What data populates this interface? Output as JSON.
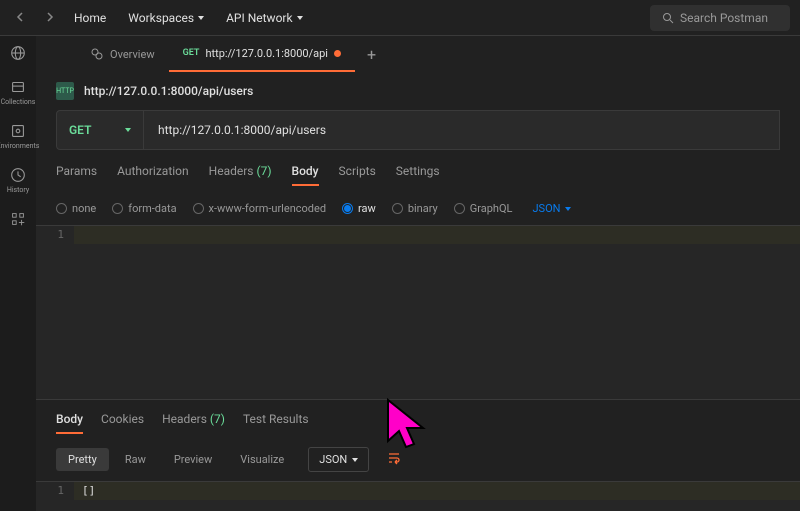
{
  "top": {
    "home": "Home",
    "workspaces": "Workspaces",
    "api_network": "API Network",
    "search_placeholder": "Search Postman"
  },
  "sidebar": {
    "collections": "Collections",
    "environments": "Environments",
    "history": "History"
  },
  "tabs": {
    "overview": "Overview",
    "active_method": "GET",
    "active_label": "http://127.0.0.1:8000/api"
  },
  "breadcrumb": {
    "url": "http://127.0.0.1:8000/api/users"
  },
  "request": {
    "method": "GET",
    "url": "http://127.0.0.1:8000/api/users"
  },
  "req_tabs": {
    "params": "Params",
    "authorization": "Authorization",
    "headers": "Headers",
    "headers_count": "(7)",
    "body": "Body",
    "scripts": "Scripts",
    "settings": "Settings"
  },
  "body_types": {
    "none": "none",
    "form_data": "form-data",
    "urlencoded": "x-www-form-urlencoded",
    "raw": "raw",
    "binary": "binary",
    "graphql": "GraphQL",
    "content_type": "JSON"
  },
  "editor": {
    "line1": "1",
    "line1_content": ""
  },
  "resp_tabs": {
    "body": "Body",
    "cookies": "Cookies",
    "headers": "Headers",
    "headers_count": "(7)",
    "test_results": "Test Results"
  },
  "resp_controls": {
    "pretty": "Pretty",
    "raw": "Raw",
    "preview": "Preview",
    "visualize": "Visualize",
    "format": "JSON"
  },
  "response": {
    "line1": "1",
    "line1_content": "[]"
  }
}
